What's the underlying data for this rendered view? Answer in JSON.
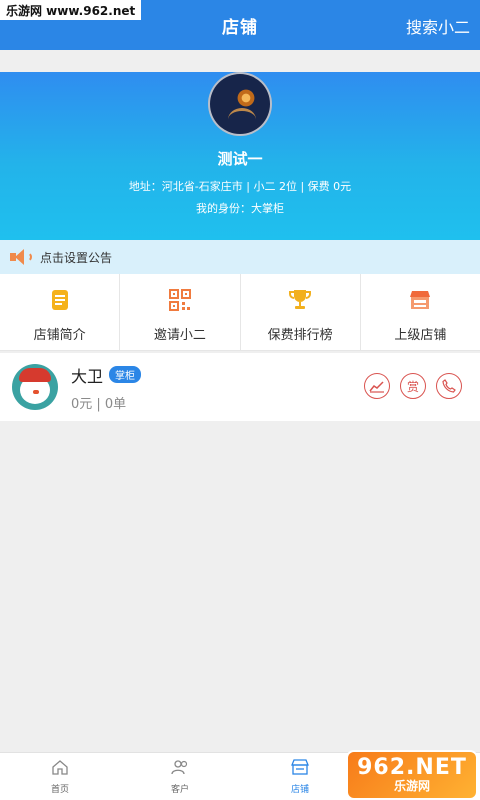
{
  "watermark_top": "乐游网 www.962.net",
  "header": {
    "title": "店铺",
    "right_action": "搜索小二"
  },
  "hero": {
    "name": "测试一",
    "address_line": "地址：河北省-石家庄市 | 小二  2位 | 保费 0元",
    "role_line": "我的身份：大掌柜"
  },
  "notice": {
    "text": "点击设置公告",
    "icon": "speaker-icon"
  },
  "grid": [
    {
      "label": "店铺简介",
      "icon": "document-icon"
    },
    {
      "label": "邀请小二",
      "icon": "qrcode-icon"
    },
    {
      "label": "保费排行榜",
      "icon": "trophy-icon"
    },
    {
      "label": "上级店铺",
      "icon": "store-icon"
    }
  ],
  "member": {
    "name": "大卫",
    "badge": "掌柜",
    "stats": "0元 | 0单",
    "actions": [
      {
        "label": "",
        "icon": "chart-icon"
      },
      {
        "label": "赏",
        "icon": "reward-icon"
      },
      {
        "label": "",
        "icon": "phone-icon"
      }
    ]
  },
  "tabbar": [
    {
      "label": "首页",
      "icon": "home-icon"
    },
    {
      "label": "客户",
      "icon": "customers-icon"
    },
    {
      "label": "店铺",
      "icon": "shop-icon",
      "active": true
    }
  ],
  "watermark_bottom": {
    "big": "962.NET",
    "small": "乐游网"
  },
  "colors": {
    "primary": "#2b86e6",
    "accent_red": "#d9534f",
    "notice_bg": "#d9f0fb"
  }
}
